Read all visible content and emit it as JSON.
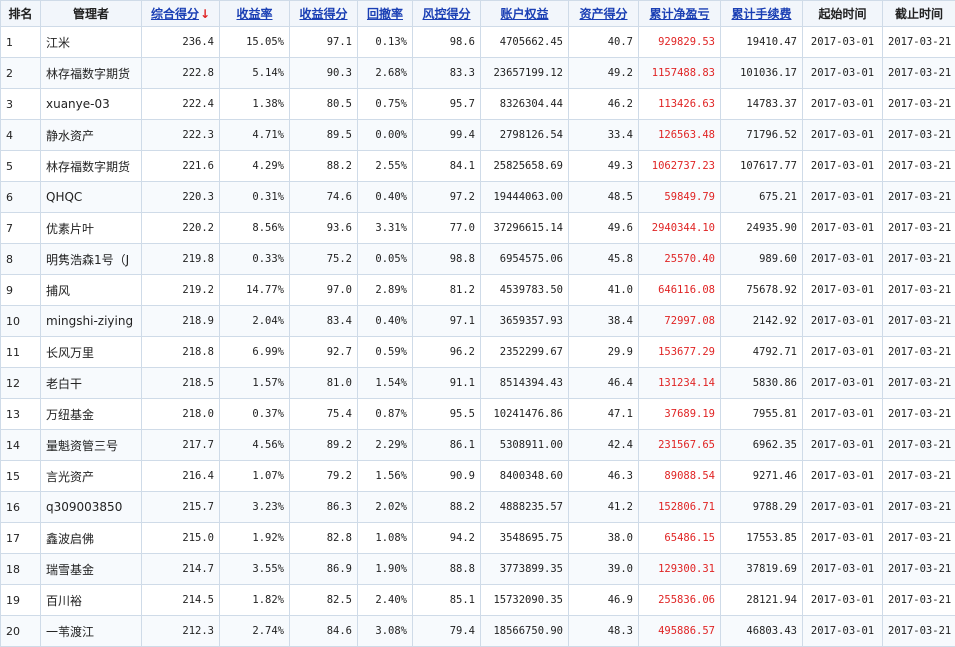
{
  "colors": {
    "accent_link": "#1a3fb4",
    "pnl_red": "#e02424",
    "border": "#cfdbe8"
  },
  "headers": {
    "rank": "排名",
    "manager": "管理者",
    "total_score": "综合得分",
    "sort_indicator": "↓",
    "return_rate": "收益率",
    "return_score": "收益得分",
    "drawdown": "回撤率",
    "risk_score": "风控得分",
    "equity": "账户权益",
    "asset_score": "资产得分",
    "cum_pnl": "累计净盈亏",
    "cum_fee": "累计手续费",
    "start": "起始时间",
    "end": "截止时间"
  },
  "rows": [
    {
      "rank": "1",
      "manager": "江米",
      "total": "236.4",
      "ret": "15.05%",
      "ret_score": "97.1",
      "dd": "0.13%",
      "risk": "98.6",
      "equity": "4705662.45",
      "asset": "40.7",
      "pnl": "929829.53",
      "fee": "19410.47",
      "start": "2017-03-01",
      "end": "2017-03-21"
    },
    {
      "rank": "2",
      "manager": "林存福数字期货",
      "total": "222.8",
      "ret": "5.14%",
      "ret_score": "90.3",
      "dd": "2.68%",
      "risk": "83.3",
      "equity": "23657199.12",
      "asset": "49.2",
      "pnl": "1157488.83",
      "fee": "101036.17",
      "start": "2017-03-01",
      "end": "2017-03-21"
    },
    {
      "rank": "3",
      "manager": "xuanye-03",
      "total": "222.4",
      "ret": "1.38%",
      "ret_score": "80.5",
      "dd": "0.75%",
      "risk": "95.7",
      "equity": "8326304.44",
      "asset": "46.2",
      "pnl": "113426.63",
      "fee": "14783.37",
      "start": "2017-03-01",
      "end": "2017-03-21"
    },
    {
      "rank": "4",
      "manager": "静水资产",
      "total": "222.3",
      "ret": "4.71%",
      "ret_score": "89.5",
      "dd": "0.00%",
      "risk": "99.4",
      "equity": "2798126.54",
      "asset": "33.4",
      "pnl": "126563.48",
      "fee": "71796.52",
      "start": "2017-03-01",
      "end": "2017-03-21"
    },
    {
      "rank": "5",
      "manager": "林存福数字期货",
      "total": "221.6",
      "ret": "4.29%",
      "ret_score": "88.2",
      "dd": "2.55%",
      "risk": "84.1",
      "equity": "25825658.69",
      "asset": "49.3",
      "pnl": "1062737.23",
      "fee": "107617.77",
      "start": "2017-03-01",
      "end": "2017-03-21"
    },
    {
      "rank": "6",
      "manager": "QHQC",
      "total": "220.3",
      "ret": "0.31%",
      "ret_score": "74.6",
      "dd": "0.40%",
      "risk": "97.2",
      "equity": "19444063.00",
      "asset": "48.5",
      "pnl": "59849.79",
      "fee": "675.21",
      "start": "2017-03-01",
      "end": "2017-03-21"
    },
    {
      "rank": "7",
      "manager": "优素片叶",
      "total": "220.2",
      "ret": "8.56%",
      "ret_score": "93.6",
      "dd": "3.31%",
      "risk": "77.0",
      "equity": "37296615.14",
      "asset": "49.6",
      "pnl": "2940344.10",
      "fee": "24935.90",
      "start": "2017-03-01",
      "end": "2017-03-21"
    },
    {
      "rank": "8",
      "manager": "明隽浩森1号（J",
      "total": "219.8",
      "ret": "0.33%",
      "ret_score": "75.2",
      "dd": "0.05%",
      "risk": "98.8",
      "equity": "6954575.06",
      "asset": "45.8",
      "pnl": "25570.40",
      "fee": "989.60",
      "start": "2017-03-01",
      "end": "2017-03-21"
    },
    {
      "rank": "9",
      "manager": "捕风",
      "total": "219.2",
      "ret": "14.77%",
      "ret_score": "97.0",
      "dd": "2.89%",
      "risk": "81.2",
      "equity": "4539783.50",
      "asset": "41.0",
      "pnl": "646116.08",
      "fee": "75678.92",
      "start": "2017-03-01",
      "end": "2017-03-21"
    },
    {
      "rank": "10",
      "manager": "mingshi-ziying",
      "total": "218.9",
      "ret": "2.04%",
      "ret_score": "83.4",
      "dd": "0.40%",
      "risk": "97.1",
      "equity": "3659357.93",
      "asset": "38.4",
      "pnl": "72997.08",
      "fee": "2142.92",
      "start": "2017-03-01",
      "end": "2017-03-21"
    },
    {
      "rank": "11",
      "manager": "长风万里",
      "total": "218.8",
      "ret": "6.99%",
      "ret_score": "92.7",
      "dd": "0.59%",
      "risk": "96.2",
      "equity": "2352299.67",
      "asset": "29.9",
      "pnl": "153677.29",
      "fee": "4792.71",
      "start": "2017-03-01",
      "end": "2017-03-21"
    },
    {
      "rank": "12",
      "manager": "老白干",
      "total": "218.5",
      "ret": "1.57%",
      "ret_score": "81.0",
      "dd": "1.54%",
      "risk": "91.1",
      "equity": "8514394.43",
      "asset": "46.4",
      "pnl": "131234.14",
      "fee": "5830.86",
      "start": "2017-03-01",
      "end": "2017-03-21"
    },
    {
      "rank": "13",
      "manager": "万纽基金",
      "total": "218.0",
      "ret": "0.37%",
      "ret_score": "75.4",
      "dd": "0.87%",
      "risk": "95.5",
      "equity": "10241476.86",
      "asset": "47.1",
      "pnl": "37689.19",
      "fee": "7955.81",
      "start": "2017-03-01",
      "end": "2017-03-21"
    },
    {
      "rank": "14",
      "manager": "量魁资管三号",
      "total": "217.7",
      "ret": "4.56%",
      "ret_score": "89.2",
      "dd": "2.29%",
      "risk": "86.1",
      "equity": "5308911.00",
      "asset": "42.4",
      "pnl": "231567.65",
      "fee": "6962.35",
      "start": "2017-03-01",
      "end": "2017-03-21"
    },
    {
      "rank": "15",
      "manager": "言光资产",
      "total": "216.4",
      "ret": "1.07%",
      "ret_score": "79.2",
      "dd": "1.56%",
      "risk": "90.9",
      "equity": "8400348.60",
      "asset": "46.3",
      "pnl": "89088.54",
      "fee": "9271.46",
      "start": "2017-03-01",
      "end": "2017-03-21"
    },
    {
      "rank": "16",
      "manager": "q309003850",
      "total": "215.7",
      "ret": "3.23%",
      "ret_score": "86.3",
      "dd": "2.02%",
      "risk": "88.2",
      "equity": "4888235.57",
      "asset": "41.2",
      "pnl": "152806.71",
      "fee": "9788.29",
      "start": "2017-03-01",
      "end": "2017-03-21"
    },
    {
      "rank": "17",
      "manager": "鑫波启佛",
      "total": "215.0",
      "ret": "1.92%",
      "ret_score": "82.8",
      "dd": "1.08%",
      "risk": "94.2",
      "equity": "3548695.75",
      "asset": "38.0",
      "pnl": "65486.15",
      "fee": "17553.85",
      "start": "2017-03-01",
      "end": "2017-03-21"
    },
    {
      "rank": "18",
      "manager": "瑞雪基金",
      "total": "214.7",
      "ret": "3.55%",
      "ret_score": "86.9",
      "dd": "1.90%",
      "risk": "88.8",
      "equity": "3773899.35",
      "asset": "39.0",
      "pnl": "129300.31",
      "fee": "37819.69",
      "start": "2017-03-01",
      "end": "2017-03-21"
    },
    {
      "rank": "19",
      "manager": "百川裕",
      "total": "214.5",
      "ret": "1.82%",
      "ret_score": "82.5",
      "dd": "2.40%",
      "risk": "85.1",
      "equity": "15732090.35",
      "asset": "46.9",
      "pnl": "255836.06",
      "fee": "28121.94",
      "start": "2017-03-01",
      "end": "2017-03-21"
    },
    {
      "rank": "20",
      "manager": "一苇渡江",
      "total": "212.3",
      "ret": "2.74%",
      "ret_score": "84.6",
      "dd": "3.08%",
      "risk": "79.4",
      "equity": "18566750.90",
      "asset": "48.3",
      "pnl": "495886.57",
      "fee": "46803.43",
      "start": "2017-03-01",
      "end": "2017-03-21"
    }
  ]
}
